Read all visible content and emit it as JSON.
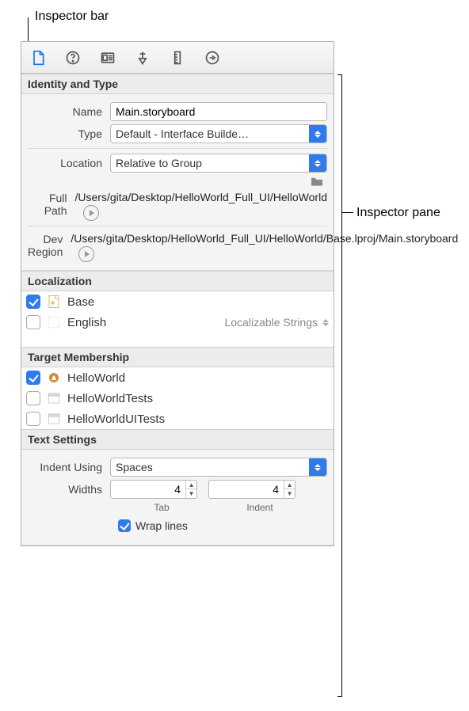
{
  "annotations": {
    "bar": "Inspector bar",
    "pane": "Inspector pane"
  },
  "sections": {
    "identity": {
      "title": "Identity and Type",
      "name_label": "Name",
      "name_value": "Main.storyboard",
      "type_label": "Type",
      "type_value": "Default - Interface Builde…",
      "location_label": "Location",
      "location_value": "Relative to Group",
      "fullpath_label": "Full Path",
      "fullpath_value": "/Users/gita/Desktop/HelloWorld_Full_UI/HelloWorld",
      "devregion_label": "Dev Region",
      "devregion_value": "/Users/gita/Desktop/HelloWorld_Full_UI/HelloWorld/Base.lproj/Main.storyboard"
    },
    "localization": {
      "title": "Localization",
      "items": [
        {
          "label": "Base",
          "checked": true
        },
        {
          "label": "English",
          "checked": false,
          "menu": "Localizable Strings"
        }
      ]
    },
    "targets": {
      "title": "Target Membership",
      "items": [
        {
          "label": "HelloWorld",
          "checked": true,
          "icon": "app"
        },
        {
          "label": "HelloWorldTests",
          "checked": false,
          "icon": "bundle"
        },
        {
          "label": "HelloWorldUITests",
          "checked": false,
          "icon": "bundle"
        }
      ]
    },
    "text": {
      "title": "Text Settings",
      "indent_label": "Indent Using",
      "indent_value": "Spaces",
      "widths_label": "Widths",
      "tab_value": "4",
      "indent_width_value": "4",
      "tab_sub": "Tab",
      "indent_sub": "Indent",
      "wrap_label": "Wrap lines",
      "wrap_checked": true
    }
  }
}
